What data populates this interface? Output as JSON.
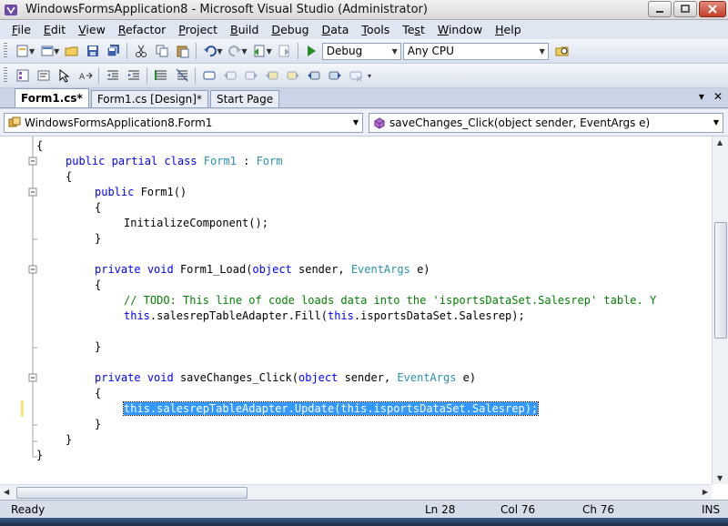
{
  "window": {
    "title": "WindowsFormsApplication8 - Microsoft Visual Studio (Administrator)"
  },
  "menu": [
    {
      "label": "File",
      "key": "F",
      "rest": "ile"
    },
    {
      "label": "Edit",
      "key": "E",
      "rest": "dit"
    },
    {
      "label": "View",
      "key": "V",
      "rest": "iew"
    },
    {
      "label": "Refactor",
      "key": "R",
      "rest": "efactor"
    },
    {
      "label": "Project",
      "key": "P",
      "rest": "roject"
    },
    {
      "label": "Build",
      "key": "B",
      "rest": "uild"
    },
    {
      "label": "Debug",
      "key": "D",
      "rest": "ebug"
    },
    {
      "label": "Data",
      "key": "D",
      "rest": "ata"
    },
    {
      "label": "Tools",
      "key": "T",
      "rest": "ools"
    },
    {
      "label": "Test",
      "key": "s",
      "pre": "Te",
      "rest": "t"
    },
    {
      "label": "Window",
      "key": "W",
      "rest": "indow"
    },
    {
      "label": "Help",
      "key": "H",
      "rest": "elp"
    }
  ],
  "toolbar": {
    "configuration": "Debug",
    "platform": "Any CPU"
  },
  "tabs": [
    {
      "label": "Form1.cs*",
      "active": true
    },
    {
      "label": "Form1.cs [Design]*",
      "active": false
    },
    {
      "label": "Start Page",
      "active": false
    }
  ],
  "tab_tools": {
    "dropdown": "▾",
    "close": "✕"
  },
  "navigation": {
    "class_combo": "WindowsFormsApplication8.Form1",
    "member_combo": "saveChanges_Click(object sender, EventArgs e)"
  },
  "code_lines": [
    {
      "indent": 0,
      "tokens": [
        {
          "t": "{"
        }
      ]
    },
    {
      "indent": 1,
      "tokens": [
        {
          "t": "public",
          "c": "kw"
        },
        {
          "t": " "
        },
        {
          "t": "partial",
          "c": "kw"
        },
        {
          "t": " "
        },
        {
          "t": "class",
          "c": "kw"
        },
        {
          "t": " "
        },
        {
          "t": "Form1",
          "c": "ty"
        },
        {
          "t": " : "
        },
        {
          "t": "Form",
          "c": "ty"
        }
      ]
    },
    {
      "indent": 1,
      "tokens": [
        {
          "t": "{"
        }
      ]
    },
    {
      "indent": 2,
      "tokens": [
        {
          "t": "public",
          "c": "kw"
        },
        {
          "t": " Form1()"
        }
      ]
    },
    {
      "indent": 2,
      "tokens": [
        {
          "t": "{"
        }
      ]
    },
    {
      "indent": 3,
      "tokens": [
        {
          "t": "InitializeComponent();"
        }
      ]
    },
    {
      "indent": 2,
      "tokens": [
        {
          "t": "}"
        }
      ]
    },
    {
      "indent": 0,
      "tokens": []
    },
    {
      "indent": 2,
      "tokens": [
        {
          "t": "private",
          "c": "kw"
        },
        {
          "t": " "
        },
        {
          "t": "void",
          "c": "kw"
        },
        {
          "t": " Form1_Load("
        },
        {
          "t": "object",
          "c": "kw"
        },
        {
          "t": " sender, "
        },
        {
          "t": "EventArgs",
          "c": "ty"
        },
        {
          "t": " e)"
        }
      ]
    },
    {
      "indent": 2,
      "tokens": [
        {
          "t": "{"
        }
      ]
    },
    {
      "indent": 3,
      "tokens": [
        {
          "t": "// TODO: This line of code loads data into the 'isportsDataSet.Salesrep' table. Y",
          "c": "cm"
        }
      ]
    },
    {
      "indent": 3,
      "tokens": [
        {
          "t": "this",
          "c": "kw"
        },
        {
          "t": ".salesrepTableAdapter.Fill("
        },
        {
          "t": "this",
          "c": "kw"
        },
        {
          "t": ".isportsDataSet.Salesrep);"
        }
      ]
    },
    {
      "indent": 0,
      "tokens": []
    },
    {
      "indent": 2,
      "tokens": [
        {
          "t": "}"
        }
      ]
    },
    {
      "indent": 0,
      "tokens": []
    },
    {
      "indent": 2,
      "tokens": [
        {
          "t": "private",
          "c": "kw"
        },
        {
          "t": " "
        },
        {
          "t": "void",
          "c": "kw"
        },
        {
          "t": " saveChanges_Click("
        },
        {
          "t": "object",
          "c": "kw"
        },
        {
          "t": " sender, "
        },
        {
          "t": "EventArgs",
          "c": "ty"
        },
        {
          "t": " e)"
        }
      ]
    },
    {
      "indent": 2,
      "tokens": [
        {
          "t": "{"
        }
      ]
    },
    {
      "indent": 3,
      "selected": true,
      "tokens": [
        {
          "t": "this.salesrepTableAdapter.Update(this.isportsDataSet.Salesrep);"
        }
      ]
    },
    {
      "indent": 2,
      "tokens": [
        {
          "t": "}"
        }
      ]
    },
    {
      "indent": 1,
      "tokens": [
        {
          "t": "}"
        }
      ]
    },
    {
      "indent": 0,
      "tokens": [
        {
          "t": "}"
        }
      ]
    }
  ],
  "status": {
    "state": "Ready",
    "line": "Ln 28",
    "col": "Col 76",
    "ch": "Ch 76",
    "mode": "INS"
  }
}
